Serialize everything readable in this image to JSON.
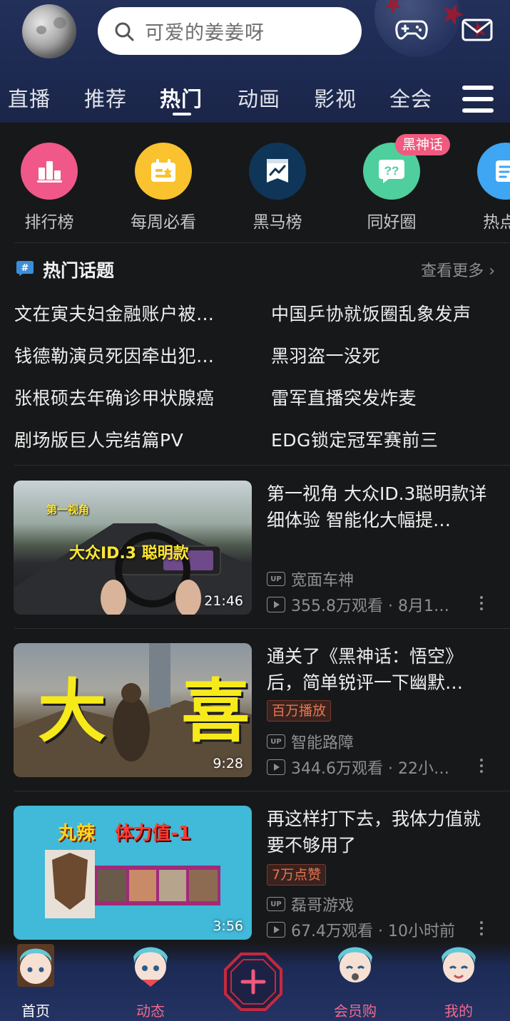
{
  "colors": {
    "header_bg": "#1d2a52",
    "page_bg": "#17181a",
    "accent_pink": "#f05a7e",
    "tag_orange": "#e4764f"
  },
  "header": {
    "search_placeholder": "可爱的姜姜呀",
    "icons": [
      "search-icon",
      "gamepad-icon",
      "mail-icon",
      "menu-icon"
    ]
  },
  "tabs": [
    {
      "label": "直播",
      "active": false
    },
    {
      "label": "推荐",
      "active": false
    },
    {
      "label": "热门",
      "active": true
    },
    {
      "label": "动画",
      "active": false
    },
    {
      "label": "影视",
      "active": false
    },
    {
      "label": "全会",
      "active": false
    }
  ],
  "entries": [
    {
      "label": "排行榜",
      "icon": "ranking-icon",
      "color": "#f0588a"
    },
    {
      "label": "每周必看",
      "icon": "calendar-icon",
      "color": "#f9c22e"
    },
    {
      "label": "黑马榜",
      "icon": "trend-chart-icon",
      "color": "#0f3658"
    },
    {
      "label": "同好圈",
      "icon": "chat-bubble-icon",
      "color": "#4ecf9d"
    },
    {
      "label": "热点D",
      "icon": "hotspot-icon",
      "color": "#3ea6f2"
    }
  ],
  "entry_badge": "黑神话",
  "hot_topics": {
    "title": "热门话题",
    "more": "查看更多",
    "items": [
      "文在寅夫妇金融账户被…",
      "中国乒协就饭圈乱象发声",
      "钱德勒演员死因牵出犯…",
      "黑羽盗一没死",
      "张根硕去年确诊甲状腺癌",
      "雷军直播突发炸麦",
      "剧场版巨人完结篇PV",
      "EDG锁定冠军赛前三"
    ]
  },
  "videos": [
    {
      "title": "第一视角 大众ID.3聪明款详细体验 智能化大幅提…",
      "duration": "21:46",
      "thumb_text_top": "第一视角",
      "thumb_text_main": "大众ID.3 聪明款",
      "tag": "",
      "uploader": "宽面车神",
      "views": "355.8万观看",
      "time": "· 8月1…"
    },
    {
      "title": "通关了《黑神话：悟空》后，简单锐评一下幽默…",
      "duration": "9:28",
      "thumb_text_main": "大 喜",
      "tag": "百万播放",
      "uploader": "智能路障",
      "views": "344.6万观看",
      "time": "· 22小…"
    },
    {
      "title": "再这样打下去，我体力值就要不够用了",
      "duration": "3:56",
      "thumb_text_left": "丸辣",
      "thumb_text_right": "体力值-1",
      "tag": "7万点赞",
      "uploader": "磊哥游戏",
      "views": "67.4万观看",
      "time": "· 10小时前"
    }
  ],
  "bottom_nav": [
    {
      "label": "首页",
      "color": "#ffffff"
    },
    {
      "label": "动态",
      "color": "#f06a8c"
    },
    {
      "label": "会员购",
      "color": "#f06a8c"
    },
    {
      "label": "我的",
      "color": "#f06a8c"
    }
  ]
}
